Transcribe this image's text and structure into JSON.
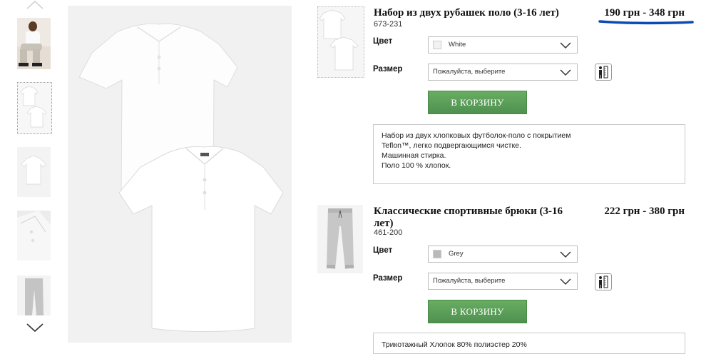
{
  "gallery": {
    "thumbnails": [
      {
        "alt": "boy-in-white-polo"
      },
      {
        "alt": "two-white-polos"
      },
      {
        "alt": "white-polo"
      },
      {
        "alt": "polo-detail"
      },
      {
        "alt": "grey-joggers"
      }
    ]
  },
  "products": [
    {
      "title": "Набор из двух рубашек поло (3-16 лет)",
      "code": "673-231",
      "price": "190 грн - 348 грн",
      "color_label": "Цвет",
      "color_value": "White",
      "color_swatch": "#f2f2f2",
      "size_label": "Размер",
      "size_value": "Пожалуйста, выберите",
      "cart_button": "В КОРЗИНУ",
      "description": [
        "Набор из двух хлопковых футболок-поло с покрытием",
        "Teflon™, легко подвергающимся чистке.",
        "Машинная стирка.",
        "Поло 100 % хлопок."
      ]
    },
    {
      "title_line1": "Классические спортивные брюки (3-16",
      "title_line2": "лет)",
      "code": "461-200",
      "price": "222 грн - 380 грн",
      "color_label": "Цвет",
      "color_value": "Grey",
      "color_swatch": "#b9b9b9",
      "size_label": "Размер",
      "size_value": "Пожалуйста, выберите",
      "cart_button": "В КОРЗИНУ",
      "description_partial": "Трикотажный   Хлопок 80%   полиэстер 20%"
    }
  ],
  "colors": {
    "button_green": "#5a9e58",
    "price_underline": "#0a4bb5"
  }
}
